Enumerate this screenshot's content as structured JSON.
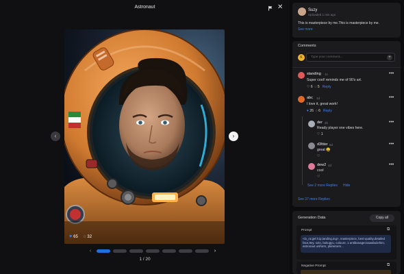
{
  "header": {
    "title": "Astronaut"
  },
  "image": {
    "likes": "65",
    "comments": "32"
  },
  "pager": {
    "count": "1 / 20",
    "active_index": 0,
    "total_dots": 7
  },
  "post": {
    "author": "Suzy",
    "uploaded": "Uploaded 1 min ago",
    "text": "This is masterpiece by me.This is masterpiece by me.",
    "see_more": "See more"
  },
  "comments": {
    "title": "Comments",
    "input_placeholder": "Type your comment...",
    "user_initial": "K",
    "items": [
      {
        "author": "standing",
        "time": "1s",
        "text": "Super cool! reminds me of 90's art.",
        "likes": "6",
        "replies": "5",
        "reply_label": "Reply"
      },
      {
        "author": "abc",
        "time": "1d",
        "text": "I love it, great work!",
        "likes": "26",
        "replies": "6",
        "reply_label": "Reply"
      }
    ],
    "replies": [
      {
        "author": "der",
        "time": "2h",
        "text": "Ready player one vibes here.",
        "likes": "1"
      },
      {
        "author": "d3fder",
        "time": "5d",
        "text": "great 😀",
        "likes": ""
      },
      {
        "author": "dew2",
        "time": "4d",
        "text": "cool",
        "likes": ""
      }
    ],
    "see_replies": "See 2 more Replies",
    "hide": "Hide",
    "see_more_replies": "See 37 more Replies"
  },
  "generation": {
    "title": "Generation Data",
    "copy_all": "Copy all",
    "prompt_label": "Prompt",
    "prompt_text": "<lo_ra:gel:lr.ip,landing,ing>, masterpiece, best-quality,detailed face,8ey, solo, bokugyu, coloure, 1 antibanagecnaaabuiiehim, astronaut uniform, planetorm...",
    "negative_label": "Negative Prompt"
  },
  "colors": {
    "accent": "#3b82f6",
    "card": "#1b1b1e",
    "background": "#101012"
  }
}
